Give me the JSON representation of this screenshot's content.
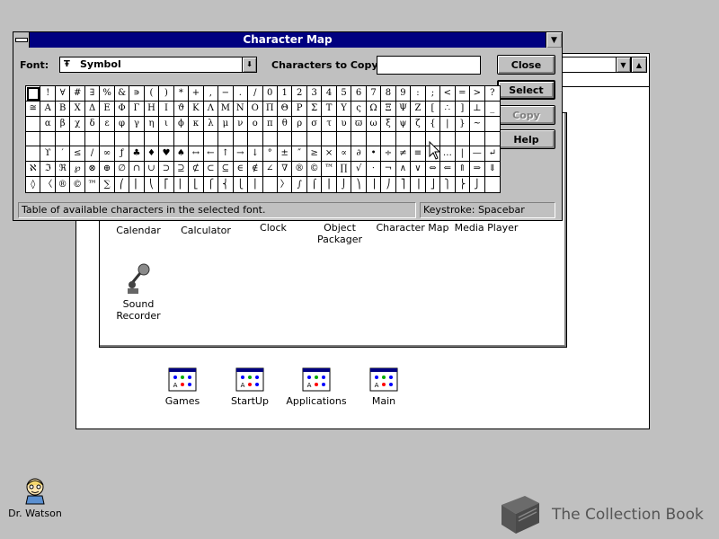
{
  "desktop": {
    "background_color": "#c0c0c0",
    "icons": [
      {
        "label": "Dr. Watson",
        "icon": "dr-watson-icon"
      }
    ]
  },
  "program_manager": {
    "group_icons": [
      {
        "label": "Games",
        "icon": "program-group-icon"
      },
      {
        "label": "StartUp",
        "icon": "program-group-icon"
      },
      {
        "label": "Applications",
        "icon": "program-group-icon"
      },
      {
        "label": "Main",
        "icon": "program-group-icon"
      }
    ]
  },
  "accessories": {
    "items": [
      {
        "label": "Calendar",
        "icon": "calendar-icon"
      },
      {
        "label": "Calculator",
        "icon": "calculator-icon"
      },
      {
        "label": "Clock",
        "icon": "clock-icon"
      },
      {
        "label": "Object\nPackager",
        "icon": "object-packager-icon"
      },
      {
        "label": "Character Map",
        "icon": "character-map-icon"
      },
      {
        "label": "Media Player",
        "icon": "media-player-icon"
      },
      {
        "label": "Sound\nRecorder",
        "icon": "sound-recorder-icon"
      }
    ]
  },
  "character_map": {
    "title": "Character Map",
    "font_label": "Font:",
    "font_value": "Symbol",
    "font_type_glyph": "Ŧ",
    "chars_to_copy_label": "Characters to Copy:",
    "chars_to_copy_value": "",
    "buttons": {
      "close": "Close",
      "select": "Select",
      "copy": "Copy",
      "help": "Help"
    },
    "grid_rows": [
      [
        " ",
        "!",
        "∀",
        "#",
        "∃",
        "%",
        "&",
        "∍",
        "(",
        ")",
        "*",
        "+",
        ",",
        "−",
        ".",
        "/",
        "0",
        "1",
        "2",
        "3",
        "4",
        "5",
        "6",
        "7",
        "8",
        "9",
        ":",
        ";",
        "<",
        "=",
        ">",
        "?"
      ],
      [
        "≅",
        "Α",
        "Β",
        "Χ",
        "Δ",
        "Ε",
        "Φ",
        "Γ",
        "Η",
        "Ι",
        "ϑ",
        "Κ",
        "Λ",
        "Μ",
        "Ν",
        "Ο",
        "Π",
        "Θ",
        "Ρ",
        "Σ",
        "Τ",
        "Υ",
        "ς",
        "Ω",
        "Ξ",
        "Ψ",
        "Ζ",
        "[",
        "∴",
        "]",
        "⊥",
        "_"
      ],
      [
        "",
        "α",
        "β",
        "χ",
        "δ",
        "ε",
        "φ",
        "γ",
        "η",
        "ι",
        "ϕ",
        "κ",
        "λ",
        "μ",
        "ν",
        "ο",
        "π",
        "θ",
        "ρ",
        "σ",
        "τ",
        "υ",
        "ϖ",
        "ω",
        "ξ",
        "ψ",
        "ζ",
        "{",
        "|",
        "}",
        "~",
        ""
      ],
      [
        "",
        "",
        "",
        "",
        "",
        "",
        "",
        "",
        "",
        "",
        "",
        "",
        "",
        "",
        "",
        "",
        "",
        "",
        "",
        "",
        "",
        "",
        "",
        "",
        "",
        "",
        "",
        "",
        "",
        "",
        "",
        ""
      ],
      [
        "",
        "ϒ",
        "′",
        "≤",
        "/",
        "∞",
        "ƒ",
        "♣",
        "♦",
        "♥",
        "♠",
        "↔",
        "←",
        "↑",
        "→",
        "↓",
        "°",
        "±",
        "″",
        "≥",
        "×",
        "∝",
        "∂",
        "•",
        "÷",
        "≠",
        "≡",
        "≈",
        "…",
        "|",
        "—",
        "↵"
      ],
      [
        "ℵ",
        "ℑ",
        "ℜ",
        "℘",
        "⊗",
        "⊕",
        "∅",
        "∩",
        "∪",
        "⊃",
        "⊇",
        "⊄",
        "⊂",
        "⊆",
        "∈",
        "∉",
        "∠",
        "∇",
        "®",
        "©",
        "™",
        "∏",
        "√",
        "⋅",
        "¬",
        "∧",
        "∨",
        "⇔",
        "⇐",
        "⇑",
        "⇒",
        "⇓"
      ],
      [
        "◊",
        "〈",
        "®",
        "©",
        "™",
        "∑",
        "⎛",
        "⎜",
        "⎝",
        "⎡",
        "⎢",
        "⎣",
        "⎧",
        "⎨",
        "⎩",
        "⎪",
        "",
        "〉",
        "∫",
        "⌠",
        "⎮",
        "⌡",
        "⎞",
        "⎟",
        "⎠",
        "⎤",
        "⎥",
        "⎦",
        "⎫",
        "⎬",
        "⎭",
        ""
      ]
    ],
    "status_text": "Table of available characters in the selected font.",
    "keystroke_text": "Keystroke: Spacebar"
  },
  "watermark": {
    "text": "The Collection Book"
  }
}
